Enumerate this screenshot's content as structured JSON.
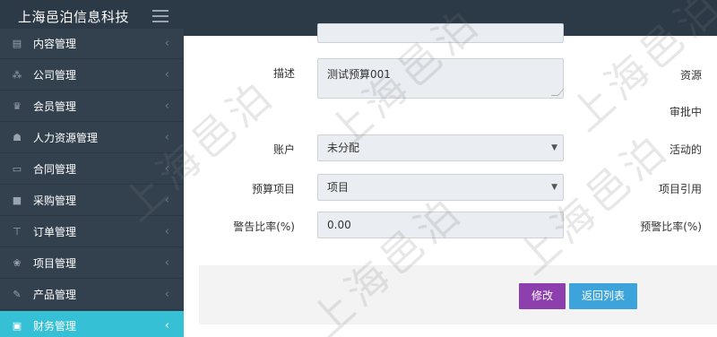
{
  "header": {
    "brand": "上海邑泊信息科技"
  },
  "sidebar": {
    "items": [
      {
        "label": "内容管理",
        "icon": "content-icon",
        "glyph": "▤"
      },
      {
        "label": "公司管理",
        "icon": "company-icon",
        "glyph": "⁂"
      },
      {
        "label": "会员管理",
        "icon": "member-icon",
        "glyph": "♛"
      },
      {
        "label": "人力资源管理",
        "icon": "users-icon",
        "glyph": "☗"
      },
      {
        "label": "合同管理",
        "icon": "contract-icon",
        "glyph": "▭"
      },
      {
        "label": "采购管理",
        "icon": "purchase-icon",
        "glyph": "■"
      },
      {
        "label": "订单管理",
        "icon": "cart-icon",
        "glyph": "⊤"
      },
      {
        "label": "项目管理",
        "icon": "project-icon",
        "glyph": "❀"
      },
      {
        "label": "产品管理",
        "icon": "product-icon",
        "glyph": "✎"
      },
      {
        "label": "财务管理",
        "icon": "finance-icon",
        "glyph": "▣",
        "active": true
      }
    ],
    "chevron": "‹",
    "active_chevron": "‹"
  },
  "form": {
    "description_label": "描述",
    "description_value": "测试预算001",
    "account_label": "账户",
    "account_value": "未分配",
    "budget_item_label": "预算项目",
    "budget_item_value": "项目",
    "alert_ratio_label": "警告比率(%)",
    "alert_ratio_value": "0.00",
    "select_arrow": "▼"
  },
  "right_column": {
    "resource": "资源",
    "in_approval": "审批中",
    "active": "活动的",
    "project_ref": "项目引用",
    "warning_ratio": "预警比率(%)"
  },
  "buttons": {
    "edit": "修改",
    "back": "返回列表"
  },
  "watermark": {
    "text": "上海邑泊"
  }
}
